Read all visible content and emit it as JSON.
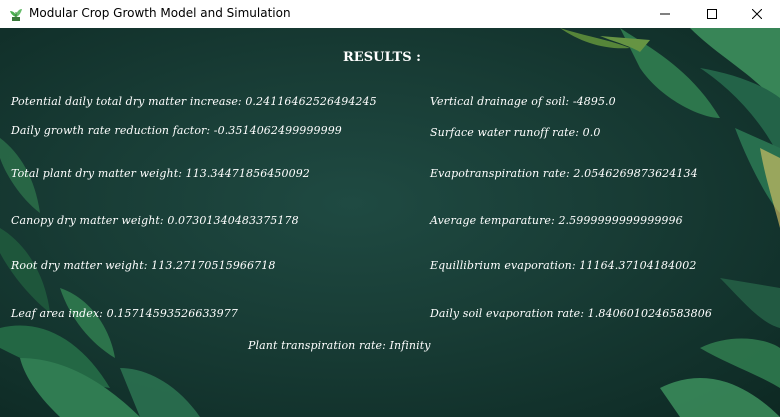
{
  "window": {
    "title": "Modular Crop Growth Model and Simulation",
    "icon": "plant-icon",
    "controls": [
      "minimize-icon",
      "maximize-icon",
      "close-icon"
    ]
  },
  "colors": {
    "background": "#183c35",
    "text": "#ffffff",
    "leaf": "#2f7a4e"
  },
  "results": {
    "heading": "RESULTS :",
    "left": [
      "Potential daily total dry matter increase: 0.24116462526494245",
      "Daily growth rate reduction factor: -0.3514062499999999",
      "Total plant dry matter weight: 113.34471856450092",
      "Canopy dry matter weight: 0.07301340483375178",
      "Root dry matter weight: 113.27170515966718",
      "Leaf area index: 0.15714593526633977"
    ],
    "right": [
      "Vertical drainage of soil: -4895.0",
      "Surface water runoff rate: 0.0",
      "Evapotranspiration rate: 2.0546269873624134",
      "Average temparature: 2.5999999999999996",
      "Equillibrium evaporation: 11164.37104184002",
      "Daily soil evaporation rate: 1.8406010246583806"
    ],
    "center": "Plant transpiration rate: Infinity"
  }
}
